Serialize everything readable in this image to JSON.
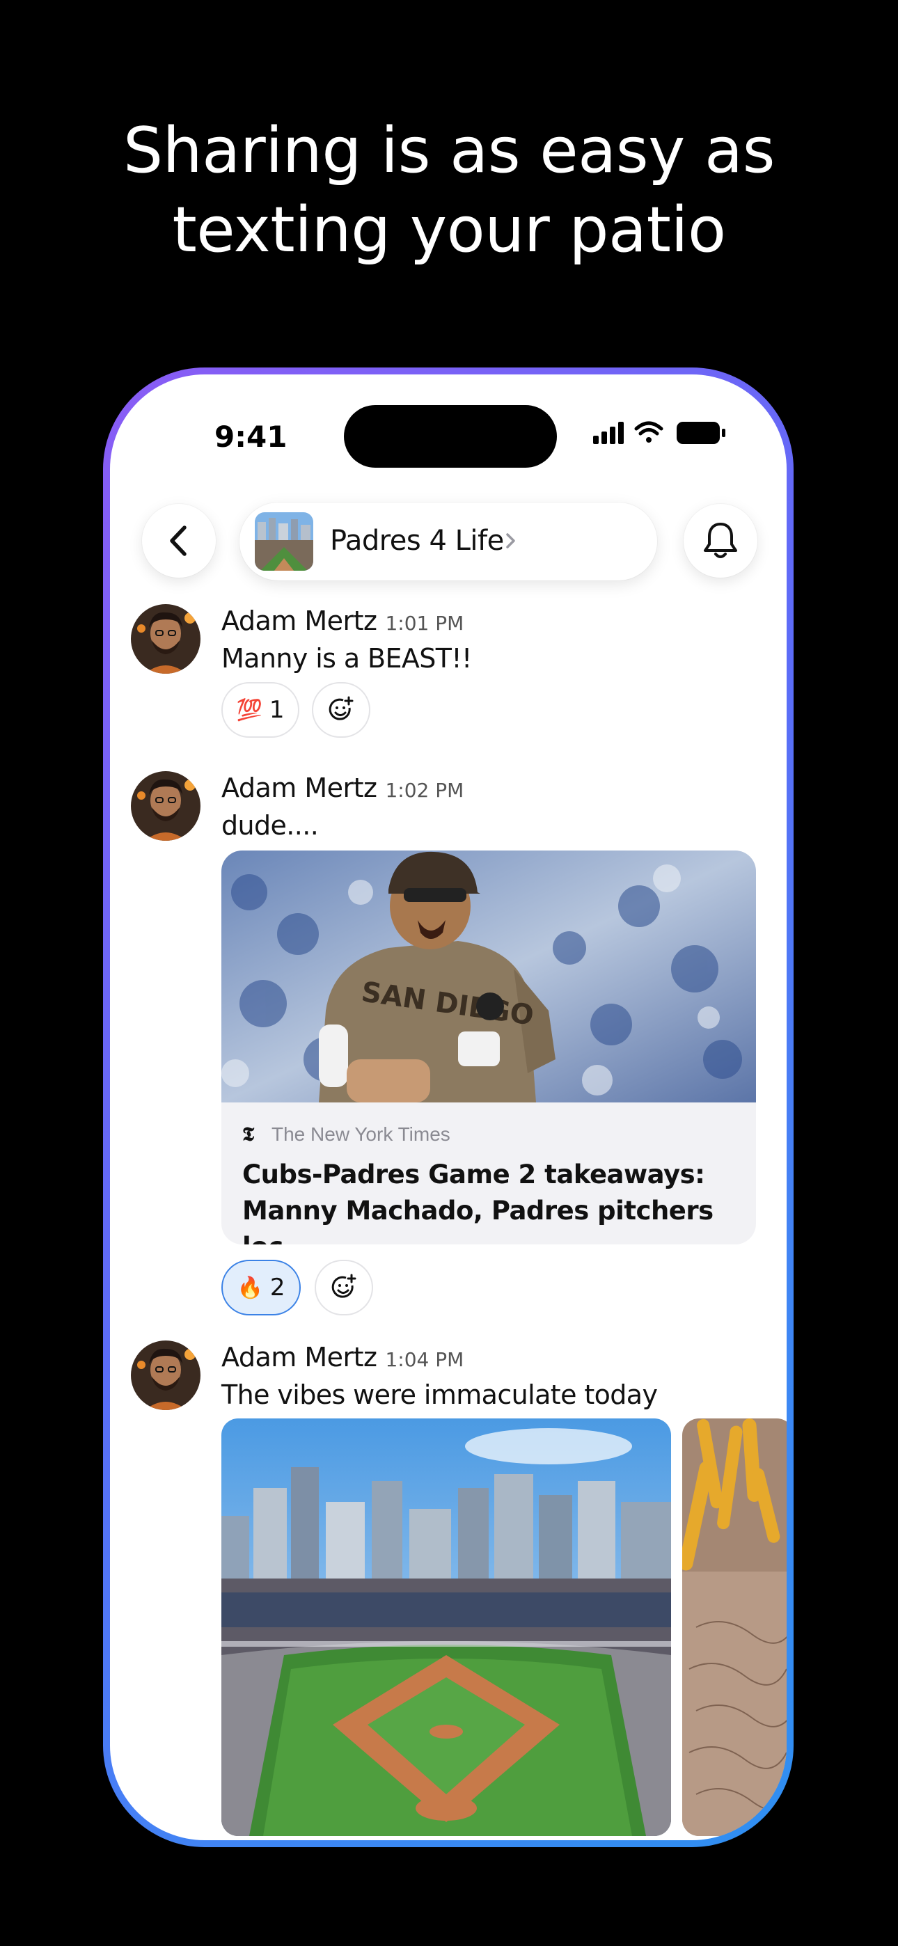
{
  "headline": {
    "line1": "Sharing is as easy as",
    "line2": "texting your patio"
  },
  "status_bar": {
    "time": "9:41"
  },
  "nav": {
    "group_name": "Padres 4 Life"
  },
  "messages": [
    {
      "author": "Adam Mertz",
      "time": "1:01 PM",
      "text": "Manny is a BEAST!!",
      "reactions": [
        {
          "emoji": "💯",
          "count": "1",
          "active": false
        }
      ]
    },
    {
      "author": "Adam Mertz",
      "time": "1:02 PM",
      "text": "dude....",
      "link": {
        "source": "The New York Times",
        "title_line1": "Cubs-Padres Game 2 takeaways:",
        "title_line2": "Manny Machado, Padres pitchers loc...."
      },
      "reactions": [
        {
          "emoji": "🔥",
          "count": "2",
          "active": true
        }
      ]
    },
    {
      "author": "Adam Mertz",
      "time": "1:04 PM",
      "text": "The vibes were immaculate today"
    }
  ],
  "colors": {
    "frame_start": "#8a5cf5",
    "frame_end": "#2f8ff1",
    "reaction_active_bg": "#e2eefc",
    "reaction_active_border": "#3b82e6"
  },
  "icons": [
    "back-chevron-icon",
    "bell-icon",
    "chevron-right-icon",
    "add-reaction-icon",
    "signal-icon",
    "wifi-icon",
    "battery-icon",
    "nyt-logo-icon"
  ]
}
